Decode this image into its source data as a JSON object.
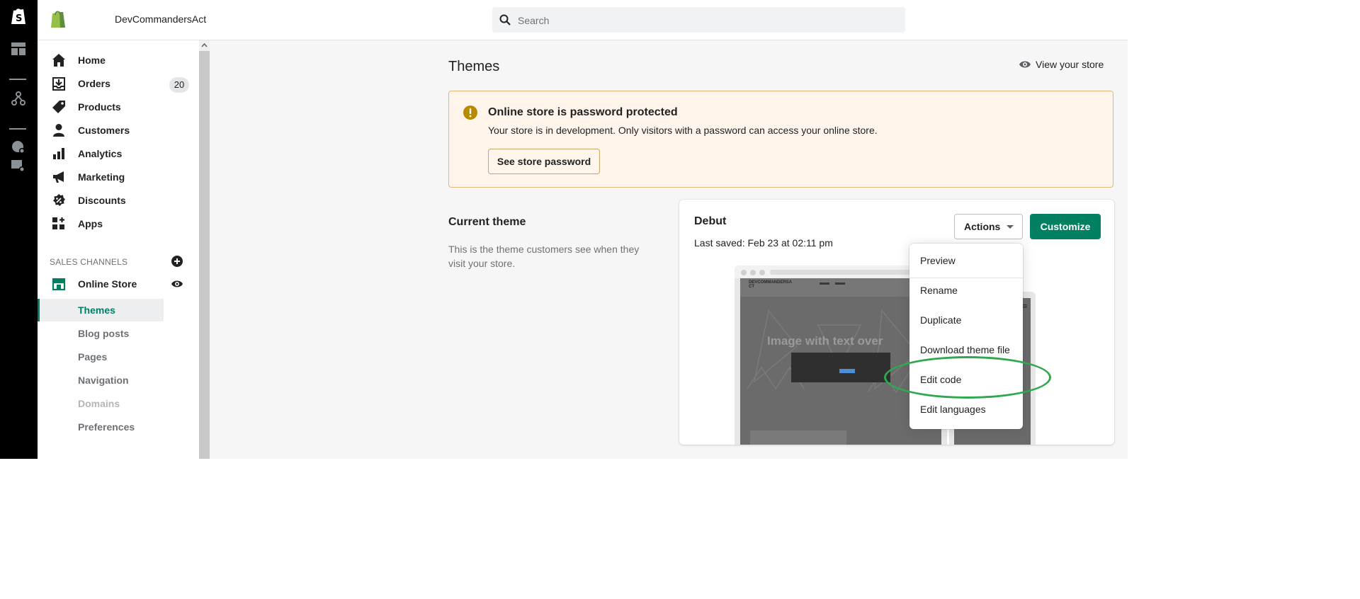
{
  "store": {
    "name": "DevCommandersAct"
  },
  "search": {
    "placeholder": "Search"
  },
  "sidebar": {
    "items": [
      {
        "label": "Home",
        "icon": "home-icon"
      },
      {
        "label": "Orders",
        "icon": "orders-icon",
        "badge": "20"
      },
      {
        "label": "Products",
        "icon": "tag-icon"
      },
      {
        "label": "Customers",
        "icon": "person-icon"
      },
      {
        "label": "Analytics",
        "icon": "bar-chart-icon"
      },
      {
        "label": "Marketing",
        "icon": "megaphone-icon"
      },
      {
        "label": "Discounts",
        "icon": "discount-icon"
      },
      {
        "label": "Apps",
        "icon": "apps-icon"
      }
    ],
    "channels_heading": "SALES CHANNELS",
    "online_store": {
      "label": "Online Store",
      "icon": "store-icon"
    },
    "sub_items": [
      {
        "label": "Themes",
        "state": "active"
      },
      {
        "label": "Blog posts",
        "state": "normal"
      },
      {
        "label": "Pages",
        "state": "normal"
      },
      {
        "label": "Navigation",
        "state": "normal"
      },
      {
        "label": "Domains",
        "state": "disabled"
      },
      {
        "label": "Preferences",
        "state": "normal"
      }
    ]
  },
  "main": {
    "title": "Themes",
    "view_store_label": "View your store",
    "banner": {
      "title": "Online store is password protected",
      "text": "Your store is in development. Only visitors with a password can access your online store.",
      "button_label": "See store password"
    },
    "current_theme": {
      "heading": "Current theme",
      "description": "This is the theme customers see when they visit your store.",
      "theme_name": "Debut",
      "last_saved": "Last saved: Feb 23 at 02:11 pm",
      "actions_label": "Actions",
      "customize_label": "Customize",
      "preview": {
        "brand": "DEVCOMMANDERSA CT",
        "headline": "Image with text over"
      }
    },
    "actions_menu": {
      "items": [
        "Preview",
        "Rename",
        "Duplicate",
        "Download theme file",
        "Edit code",
        "Edit languages"
      ],
      "highlighted": "Edit code"
    }
  },
  "colors": {
    "accent": "#008060",
    "warning_bg": "#fff5ea",
    "warning_border": "#e1b878",
    "warning_icon": "#b98900",
    "highlight_ellipse": "#2fa84f",
    "rail": "#000000"
  }
}
